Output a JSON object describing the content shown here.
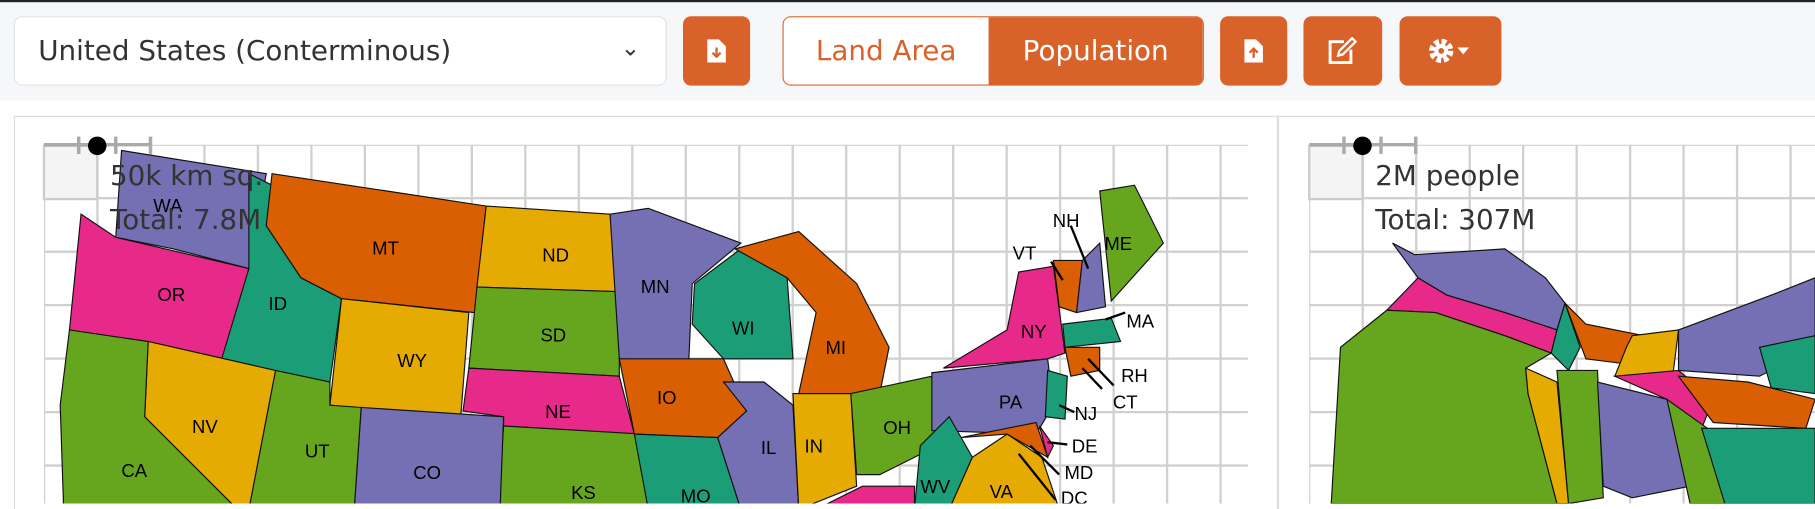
{
  "toolbar": {
    "region_select": {
      "value": "United States (Conterminous)",
      "icon": "chevron-down-icon"
    },
    "download_icon": "file-download-icon",
    "toggle": {
      "land_area": "Land Area",
      "population": "Population",
      "selected": "Population"
    },
    "upload_icon": "file-upload-icon",
    "edit_icon": "edit-icon",
    "settings_icon": "gear-dropdown-icon"
  },
  "colors": {
    "accent": "#d9622b",
    "purple": "#7570b3",
    "pink": "#e7298a",
    "green": "#66a61e",
    "orange": "#d95f02",
    "teal": "#1b9e77",
    "yellow": "#e6ab02"
  },
  "left_map": {
    "scale_label": "50k km sq.",
    "total_label": "Total: 7.8M",
    "states": [
      "WA",
      "OR",
      "ID",
      "MT",
      "ND",
      "MN",
      "WY",
      "SD",
      "WI",
      "MI",
      "NE",
      "IO",
      "IL",
      "IN",
      "OH",
      "PA",
      "NY",
      "VT",
      "NH",
      "ME",
      "MA",
      "RH",
      "CT",
      "NJ",
      "DE",
      "MD",
      "DC",
      "WV",
      "VA",
      "CA",
      "NV",
      "UT",
      "CO",
      "KS",
      "MO"
    ]
  },
  "right_map": {
    "scale_label": "2M people",
    "total_label": "Total: 307M"
  }
}
